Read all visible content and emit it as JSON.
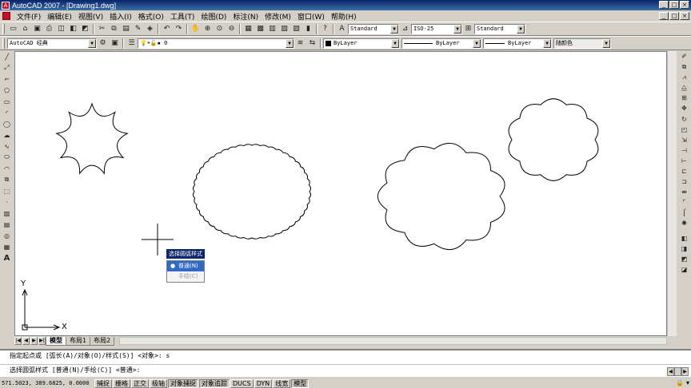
{
  "window": {
    "title": "AutoCAD 2007 - [Drawing1.dwg]",
    "controls": [
      "_",
      "□",
      "×"
    ]
  },
  "menu": [
    "文件(F)",
    "编辑(E)",
    "视图(V)",
    "插入(I)",
    "格式(O)",
    "工具(T)",
    "绘图(D)",
    "标注(N)",
    "修改(M)",
    "窗口(W)",
    "帮助(H)"
  ],
  "toolbar1": {
    "text_style": "Standard",
    "dim_style": "ISO-25",
    "table_style": "Standard"
  },
  "toolbar2": {
    "workspace": "AutoCAD 经典",
    "layer": "0",
    "color": "ByLayer",
    "linetype": "ByLayer",
    "lineweight": "ByLayer",
    "plot_style": "随颜色"
  },
  "canvas": {
    "ucs_y": "Y",
    "ucs_x": "X"
  },
  "tooltip": "选择圆弧样式",
  "context_menu": {
    "items": [
      {
        "label": "普通(N)",
        "selected": true
      },
      {
        "label": "手绘(C)",
        "selected": false
      }
    ]
  },
  "layout_tabs": [
    "模型",
    "布局1",
    "布局2"
  ],
  "command": {
    "history": "指定起点或 [弧长(A)/对象(O)/样式(S)] <对象>: s",
    "prompt": "选择圆弧样式 [普通(N)/手绘(C)] <普通>:"
  },
  "status": {
    "coordinates": "571.5023, 389.6825, 0.0000",
    "buttons": [
      "捕捉",
      "栅格",
      "正交",
      "极轴",
      "对象捕捉",
      "对象追踪",
      "DUCS",
      "DYN",
      "线宽",
      "模型"
    ],
    "on": [
      "对象捕捉",
      "对象追踪",
      "模型"
    ]
  }
}
